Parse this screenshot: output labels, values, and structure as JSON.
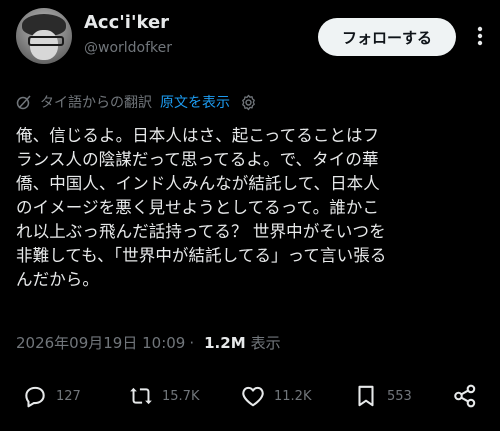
{
  "author": {
    "display_name": "Acc'i'ker",
    "handle": "@worldofker"
  },
  "follow_button": {
    "label": "フォローする"
  },
  "translation": {
    "source_label": "タイ語からの翻訳",
    "show_original_label": "原文を表示"
  },
  "tweet": {
    "text": "俺、信じるよ。日本人はさ、起こってることはフ\nランス人の陰謀だって思ってるよ。で、タイの華\n僑、中国人、インド人みんなが結託して、日本人\nのイメージを悪く見せようとしてるって。誰かこ\nれ以上ぶっ飛んだ話持ってる？ 世界中がそいつを\n非難しても、「世界中が結託してる」って言い張る\nんだから。"
  },
  "meta": {
    "timestamp": "2026年09月19日 10:09",
    "separator": "·",
    "views": "1.2M",
    "views_label": "表示"
  },
  "actions": {
    "replies": "127",
    "reposts": "15.7K",
    "likes": "11.2K",
    "bookmarks": "553"
  },
  "icons": {
    "reply": "reply-icon",
    "repost": "repost-icon",
    "like": "heart-icon",
    "bookmark": "bookmark-icon",
    "share": "share-icon",
    "translate": "translate-icon",
    "settings": "gear-icon",
    "more": "more-icon"
  },
  "colors": {
    "background": "#000000",
    "text": "#e7e9ea",
    "muted": "#71767b",
    "link": "#1d9bf0",
    "button_bg": "#eff3f4"
  }
}
